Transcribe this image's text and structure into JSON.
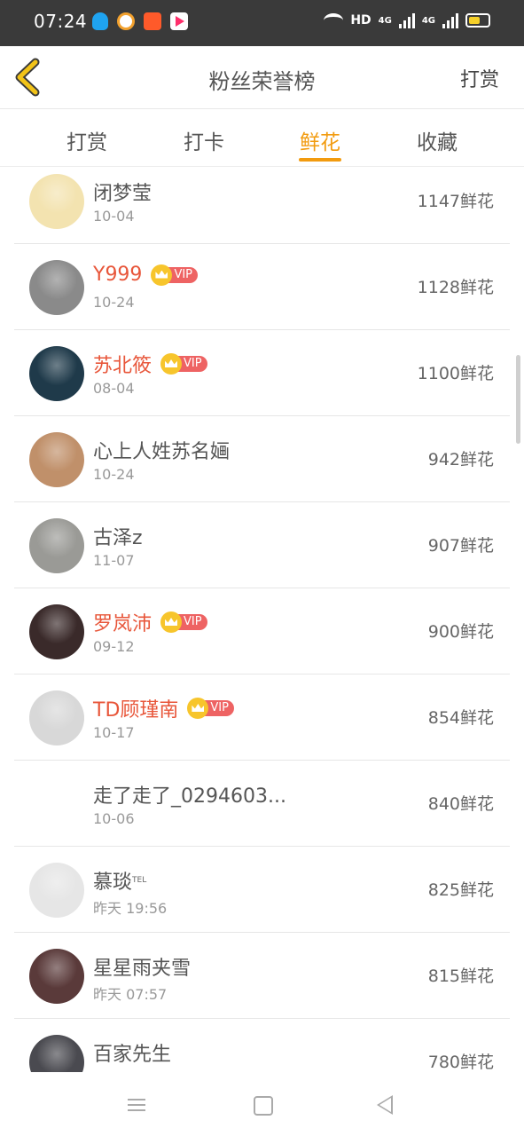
{
  "status_bar": {
    "time": "07:24",
    "hd_label": "HD",
    "net1": "4G",
    "net2": "4G"
  },
  "header": {
    "title": "粉丝荣誉榜",
    "action": "打赏"
  },
  "tabs": [
    {
      "label": "打赏",
      "active": false
    },
    {
      "label": "打卡",
      "active": false
    },
    {
      "label": "鲜花",
      "active": true
    },
    {
      "label": "收藏",
      "active": false
    }
  ],
  "vip_label": "VIP",
  "rows": [
    {
      "name": "闭梦莹",
      "date": "10-04",
      "count": "1147鲜花",
      "vip": false,
      "avatar_color": "#f3e3b0"
    },
    {
      "name": "Y999",
      "date": "10-24",
      "count": "1128鲜花",
      "vip": true,
      "avatar_color": "#8a8a8a"
    },
    {
      "name": "苏北筱",
      "date": "08-04",
      "count": "1100鲜花",
      "vip": true,
      "avatar_color": "#1f3a4a"
    },
    {
      "name": "心上人姓苏名婳",
      "date": "10-24",
      "count": "942鲜花",
      "vip": false,
      "avatar_color": "#c0906a"
    },
    {
      "name": "古泽z",
      "date": "11-07",
      "count": "907鲜花",
      "vip": false,
      "avatar_color": "#9a9a96"
    },
    {
      "name": "罗岚沛",
      "date": "09-12",
      "count": "900鲜花",
      "vip": true,
      "avatar_color": "#3a2a2a"
    },
    {
      "name": "TD顾瑾南",
      "date": "10-17",
      "count": "854鲜花",
      "vip": true,
      "avatar_color": "#d8d8d8"
    },
    {
      "name": "走了走了_0294603...",
      "date": "10-06",
      "count": "840鲜花",
      "vip": false,
      "avatar_color": "#ffffff"
    },
    {
      "name": "慕琰",
      "name_sup": "TEL",
      "date": "昨天 19:56",
      "count": "825鲜花",
      "vip": false,
      "avatar_color": "#e6e6e6"
    },
    {
      "name": "星星雨夹雪",
      "date": "昨天 07:57",
      "count": "815鲜花",
      "vip": false,
      "avatar_color": "#5a3a3a"
    },
    {
      "name": "百家先生",
      "date": "",
      "count": "780鲜花",
      "vip": false,
      "avatar_color": "#4a4a50"
    }
  ],
  "colors": {
    "accent": "#f29b0f",
    "vip_name": "#e8563a",
    "vip_badge": "#ee6363",
    "status_bar": "#3a3a3a"
  }
}
